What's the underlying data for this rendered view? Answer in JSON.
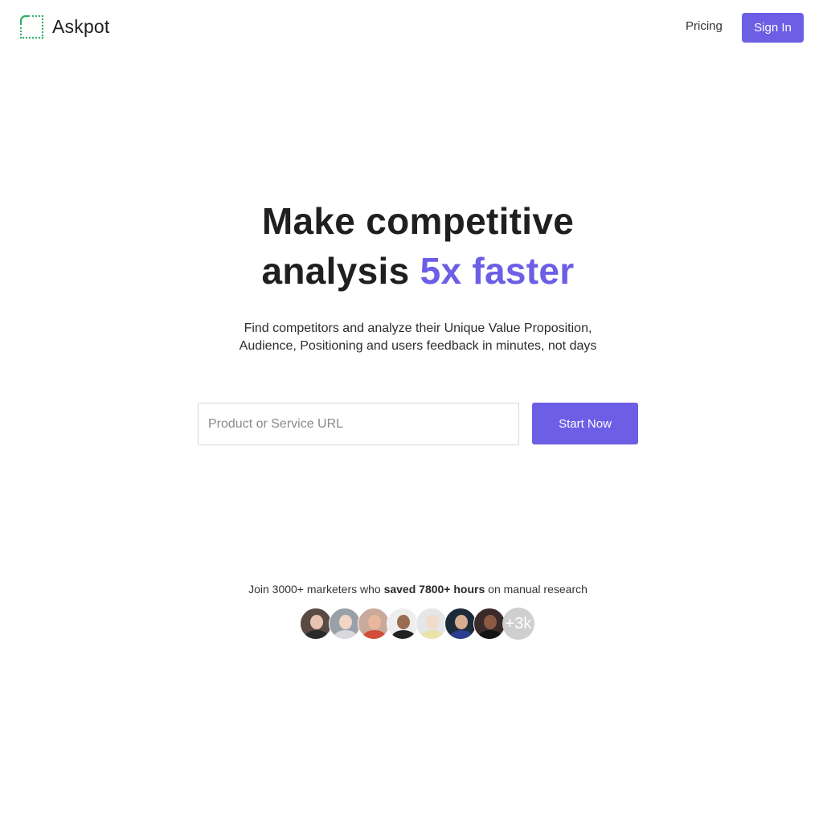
{
  "header": {
    "brand_name": "Askpot",
    "brand_icon": "dotted-square-logo-icon",
    "nav_pricing": "Pricing",
    "signin_label": "Sign In"
  },
  "hero": {
    "title_part1": "Make competitive",
    "title_part2": "analysis",
    "title_accent": "5x faster",
    "subtitle_line1": "Find competitors and analyze their Unique Value Proposition,",
    "subtitle_line2": "Audience, Positioning and users feedback in minutes, not days"
  },
  "form": {
    "url_placeholder": "Product or Service URL",
    "url_value": "",
    "start_label": "Start Now"
  },
  "proof": {
    "text_before": "Join 3000+ marketers who ",
    "text_bold": "saved 7800+ hours",
    "text_after": " on manual research",
    "more_count": "+3k"
  },
  "colors": {
    "accent": "#6d5ee6",
    "logo_green": "#2fae63",
    "text": "#1f1f1f"
  }
}
